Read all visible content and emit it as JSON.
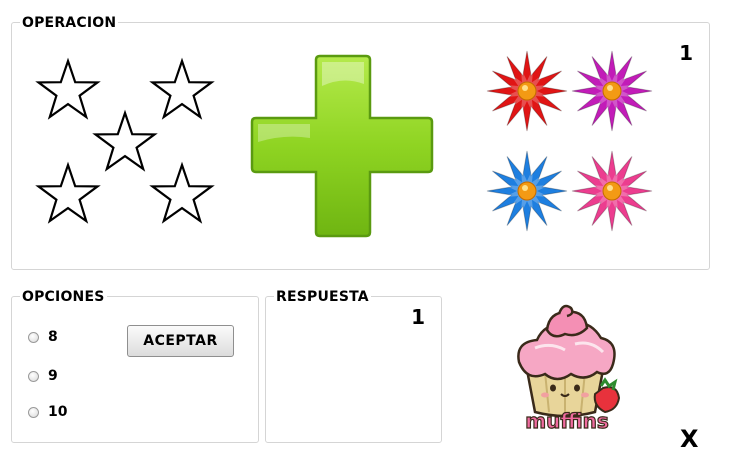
{
  "operation": {
    "title": "OPERACION",
    "count": "1",
    "left_items": {
      "icon": "star-outline-icon",
      "quantity": 5
    },
    "operator": {
      "icon": "plus-icon",
      "color": "#7ec816"
    },
    "right_items": {
      "icon": "flower-icon",
      "quantity": 4,
      "colors": [
        "#e01515",
        "#c21cb8",
        "#1e7fe0",
        "#ec3d8f"
      ]
    }
  },
  "options": {
    "title": "OPCIONES",
    "choices": [
      "8",
      "9",
      "10"
    ],
    "accept_label": "ACEPTAR"
  },
  "answer": {
    "title": "RESPUESTA",
    "count": "1"
  },
  "mascot": {
    "icon": "muffin-icon",
    "text": "muffins"
  },
  "close_label": "X"
}
